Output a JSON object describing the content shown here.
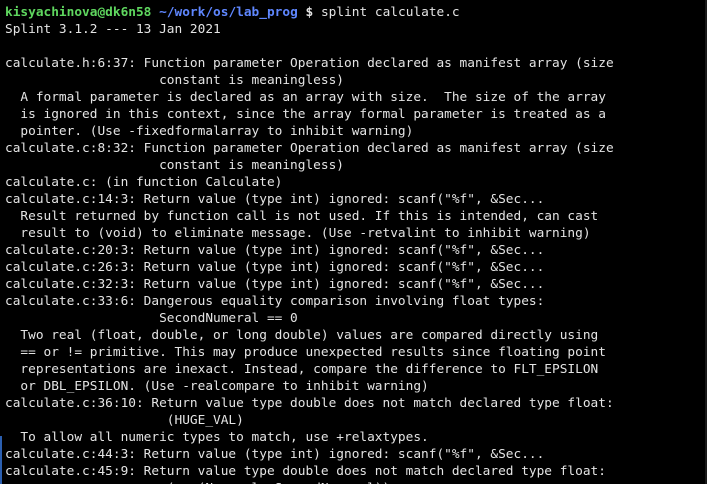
{
  "prompt": {
    "user_host": "kisyachinova@dk6n58",
    "path": "~/work/os/lab_prog",
    "symbol": "$",
    "command": "splint calculate.c"
  },
  "output": [
    "Splint 3.1.2 --- 13 Jan 2021",
    "",
    "calculate.h:6:37: Function parameter Operation declared as manifest array (size",
    "                    constant is meaningless)",
    "  A formal parameter is declared as an array with size.  The size of the array",
    "  is ignored in this context, since the array formal parameter is treated as a",
    "  pointer. (Use -fixedformalarray to inhibit warning)",
    "calculate.c:8:32: Function parameter Operation declared as manifest array (size",
    "                    constant is meaningless)",
    "calculate.c: (in function Calculate)",
    "calculate.c:14:3: Return value (type int) ignored: scanf(\"%f\", &Sec...",
    "  Result returned by function call is not used. If this is intended, can cast",
    "  result to (void) to eliminate message. (Use -retvalint to inhibit warning)",
    "calculate.c:20:3: Return value (type int) ignored: scanf(\"%f\", &Sec...",
    "calculate.c:26:3: Return value (type int) ignored: scanf(\"%f\", &Sec...",
    "calculate.c:32:3: Return value (type int) ignored: scanf(\"%f\", &Sec...",
    "calculate.c:33:6: Dangerous equality comparison involving float types:",
    "                    SecondNumeral == 0",
    "  Two real (float, double, or long double) values are compared directly using",
    "  == or != primitive. This may produce unexpected results since floating point",
    "  representations are inexact. Instead, compare the difference to FLT_EPSILON",
    "  or DBL_EPSILON. (Use -realcompare to inhibit warning)",
    "calculate.c:36:10: Return value type double does not match declared type float:",
    "                     (HUGE_VAL)",
    "  To allow all numeric types to match, use +relaxtypes.",
    "calculate.c:44:3: Return value (type int) ignored: scanf(\"%f\", &Sec...",
    "calculate.c:45:9: Return value type double does not match declared type float:",
    "                     (pow(Numeral, SecondNumeral))"
  ],
  "colors": {
    "background": "#000000",
    "text": "#e4e4e4",
    "prompt_user": "#5fd75f",
    "prompt_path": "#5f87ff"
  }
}
